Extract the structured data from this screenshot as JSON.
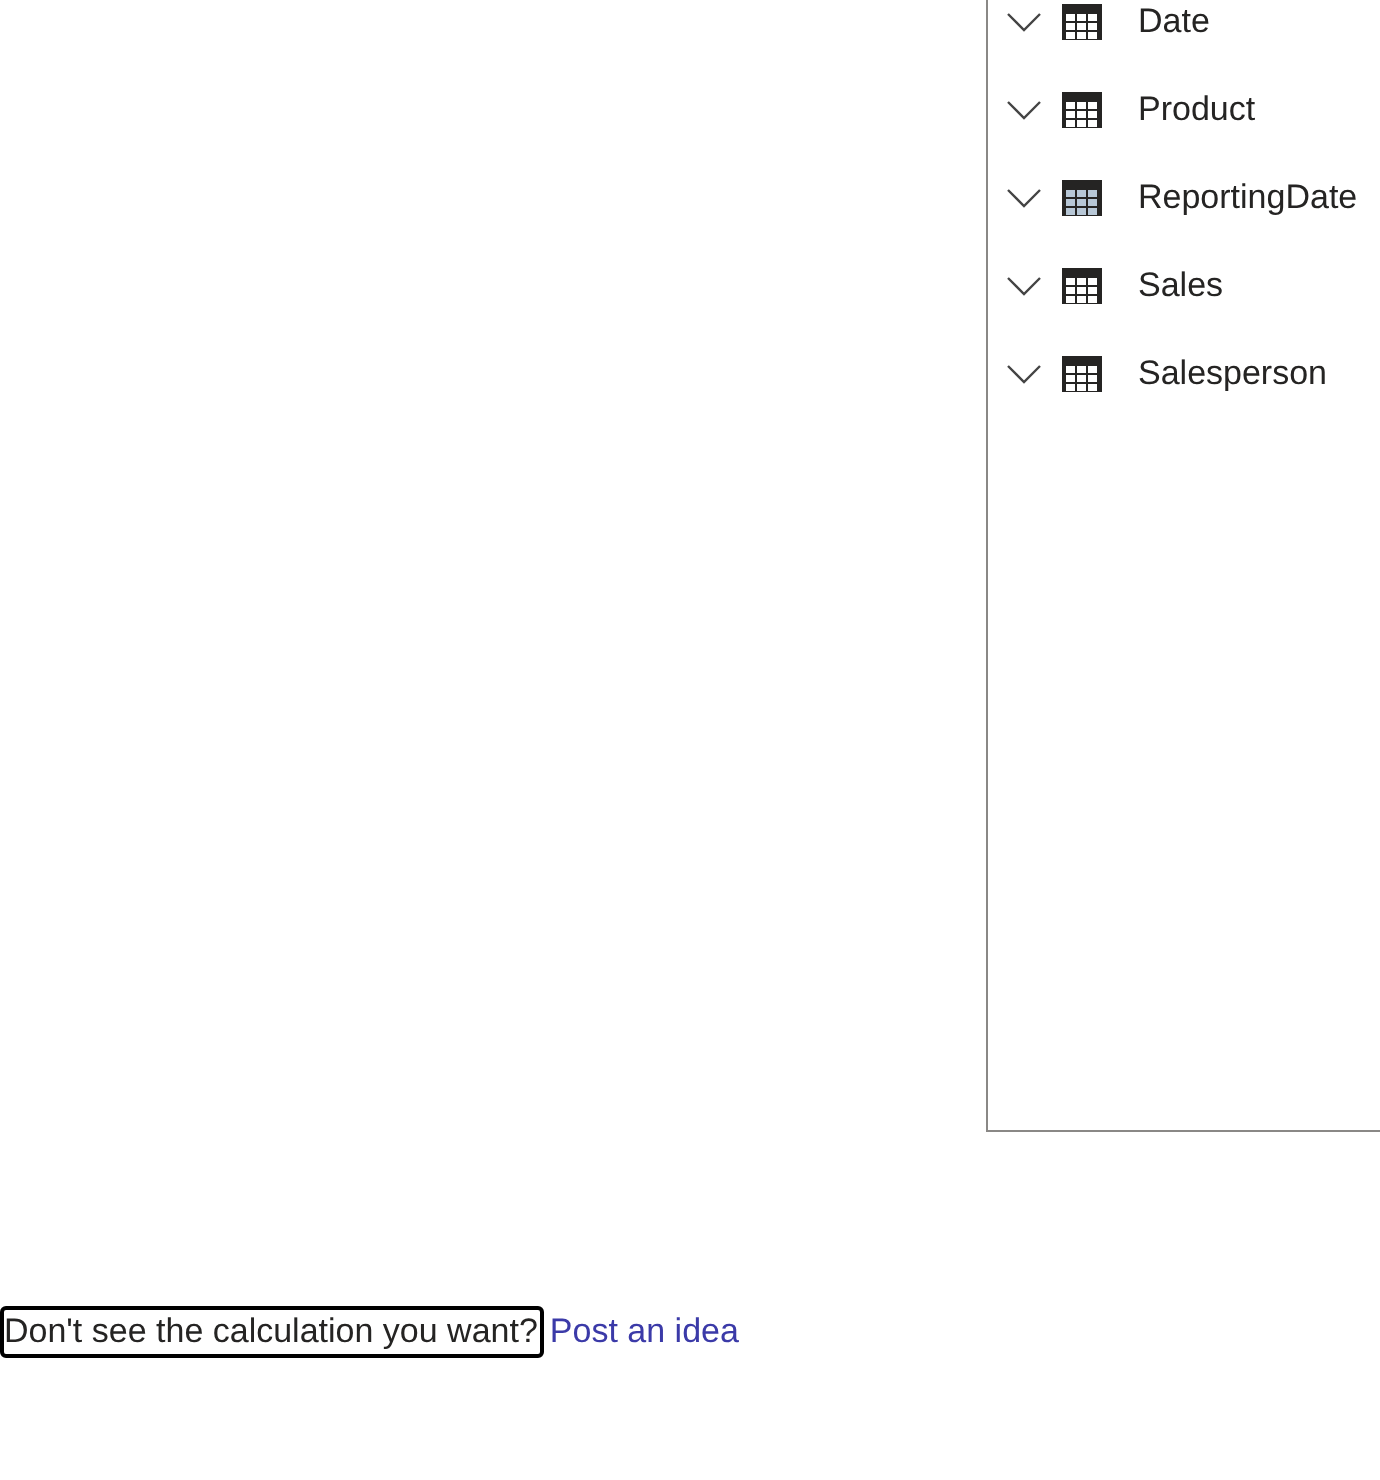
{
  "tables": [
    {
      "name": "Date",
      "kind": "table",
      "expanded": false
    },
    {
      "name": "Product",
      "kind": "table",
      "expanded": false
    },
    {
      "name": "ReportingDate",
      "kind": "date_table",
      "expanded": false
    },
    {
      "name": "Sales",
      "kind": "table",
      "expanded": false
    },
    {
      "name": "Salesperson",
      "kind": "table",
      "expanded": false
    }
  ],
  "footer": {
    "question": "Don't see the calculation you want?",
    "link": "Post an idea",
    "focused": true
  }
}
